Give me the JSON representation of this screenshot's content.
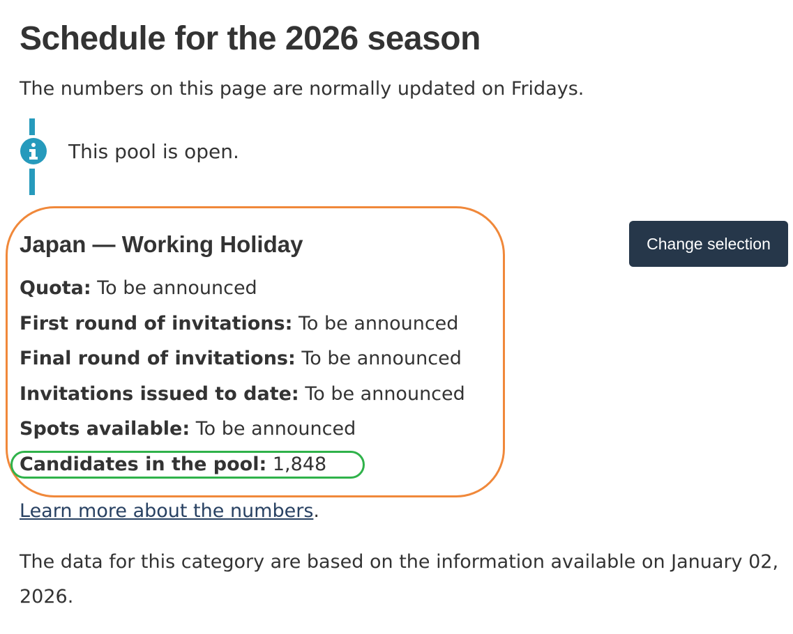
{
  "page": {
    "title": "Schedule for the 2026 season",
    "lead": "The numbers on this page are normally updated on Fridays."
  },
  "alert": {
    "icon": "info-icon",
    "text": "This pool is open.",
    "color": "#269abc"
  },
  "pool": {
    "name": "Japan — Working Holiday",
    "change_button_label": "Change selection",
    "stats": [
      {
        "label": "Quota:",
        "value": "To be announced"
      },
      {
        "label": "First round of invitations:",
        "value": "To be announced"
      },
      {
        "label": "Final round of invitations:",
        "value": "To be announced"
      },
      {
        "label": "Invitations issued to date:",
        "value": "To be announced"
      },
      {
        "label": "Spots available:",
        "value": "To be announced"
      },
      {
        "label": "Candidates in the pool:",
        "value": "1,848"
      }
    ]
  },
  "footer": {
    "learn_more_link": "Learn more about the numbers",
    "learn_more_suffix": ".",
    "data_note": "The data for this category are based on the information available on January 02, 2026."
  },
  "colors": {
    "button_bg": "#26374a",
    "link": "#284162",
    "highlight_orange": "#f0883a",
    "highlight_green": "#2fb24a"
  }
}
